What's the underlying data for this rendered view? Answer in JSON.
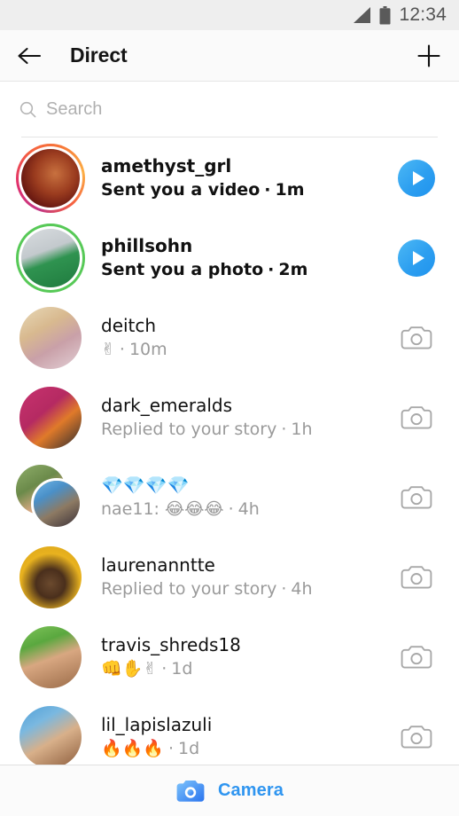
{
  "status_bar": {
    "time": "12:34",
    "signal_icon": "signal-bars-icon",
    "battery_icon": "battery-full-icon"
  },
  "header": {
    "back_icon": "back-arrow-icon",
    "title": "Direct",
    "new_message_icon": "plus-icon"
  },
  "search": {
    "icon": "search-icon",
    "placeholder": "Search",
    "value": ""
  },
  "threads": [
    {
      "username": "amethyst_grl",
      "preview": "Sent you a video",
      "time": "1m",
      "separator": "·",
      "unread": true,
      "ring": "gradient",
      "action_icon": "play-button-icon",
      "avatar_type": "single"
    },
    {
      "username": "phillsohn",
      "preview": "Sent you a photo",
      "time": "2m",
      "separator": "·",
      "unread": true,
      "ring": "green",
      "action_icon": "play-button-icon",
      "avatar_type": "single"
    },
    {
      "username": "deitch",
      "preview": "✌",
      "time": "10m",
      "separator": "·",
      "unread": false,
      "ring": "none",
      "action_icon": "camera-outline-icon",
      "avatar_type": "single"
    },
    {
      "username": "dark_emeralds",
      "preview": "Replied to your story",
      "time": "1h",
      "separator": "·",
      "unread": false,
      "ring": "none",
      "action_icon": "camera-outline-icon",
      "avatar_type": "single"
    },
    {
      "username": "💎💎💎💎",
      "preview": "nae11: 😂😂😂",
      "time": "4h",
      "separator": "·",
      "unread": false,
      "ring": "none",
      "action_icon": "camera-outline-icon",
      "avatar_type": "group"
    },
    {
      "username": "laurenanntte",
      "preview": "Replied to your story",
      "time": "4h",
      "separator": "·",
      "unread": false,
      "ring": "none",
      "action_icon": "camera-outline-icon",
      "avatar_type": "single"
    },
    {
      "username": "travis_shreds18",
      "preview": "👊✋✌",
      "time": "1d",
      "separator": "·",
      "unread": false,
      "ring": "none",
      "action_icon": "camera-outline-icon",
      "avatar_type": "single"
    },
    {
      "username": "lil_lapislazuli",
      "preview": "🔥🔥🔥",
      "time": "1d",
      "separator": "·",
      "unread": false,
      "ring": "none",
      "action_icon": "camera-outline-icon",
      "avatar_type": "single"
    }
  ],
  "bottom_bar": {
    "camera_icon": "camera-filled-icon",
    "camera_label": "Camera"
  },
  "colors": {
    "accent_blue": "#2f95f0",
    "unread_text": "#111111",
    "muted_text": "#9a9a9a",
    "status_bar_bg": "#eeeeee",
    "header_bg": "#fafafa",
    "close_friends_green": "#57c957"
  }
}
